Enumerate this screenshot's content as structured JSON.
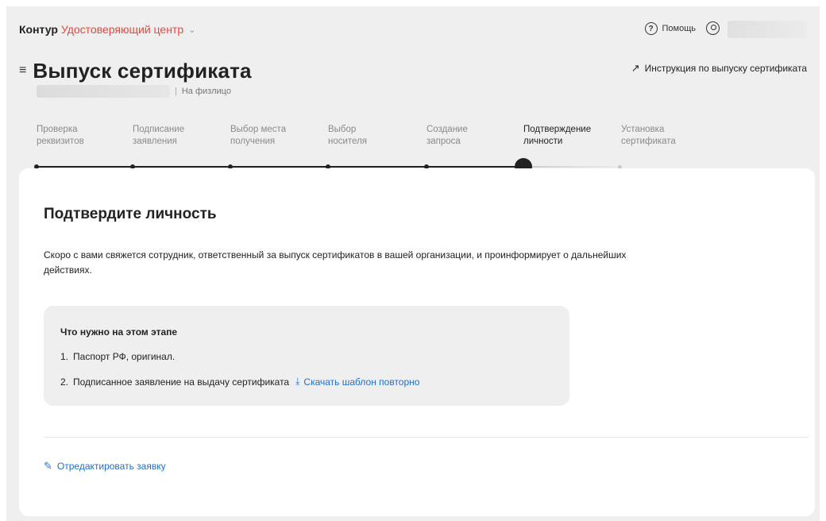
{
  "header": {
    "brand_primary": "Контур",
    "brand_product": "Удостоверяющий центр",
    "help_label": "Помощь",
    "icons": {
      "dropdown": "chevron-down-icon",
      "help": "help-circle-icon",
      "user": "user-icon"
    }
  },
  "page": {
    "title": "Выпуск сертификата",
    "instruction_link": "Инструкция по выпуску сертификата",
    "applicant_type": "На физлицо",
    "icons": {
      "menu": "menu-icon",
      "instruction": "arrow-up-right-icon"
    }
  },
  "steps": [
    {
      "line1": "Проверка",
      "line2": "реквизитов",
      "status": "done"
    },
    {
      "line1": "Подписание",
      "line2": "заявления",
      "status": "done"
    },
    {
      "line1": "Выбор места",
      "line2": "получения",
      "status": "done"
    },
    {
      "line1": "Выбор",
      "line2": "носителя",
      "status": "done"
    },
    {
      "line1": "Создание",
      "line2": "запроса",
      "status": "done"
    },
    {
      "line1": "Подтверждение",
      "line2": "личности",
      "status": "current"
    },
    {
      "line1": "Установка",
      "line2": "сертификата",
      "status": "future"
    }
  ],
  "card": {
    "title": "Подтвердите личность",
    "description": "Скоро с вами свяжется сотрудник, ответственный за выпуск сертификатов в вашей организации, и проинформирует о дальнейших действиях.",
    "requirements": {
      "title": "Что нужно на этом этапе",
      "items": [
        {
          "num": "1.",
          "text": "Паспорт РФ, оригинал."
        },
        {
          "num": "2.",
          "text": "Подписанное заявление на выдачу сертификата"
        }
      ],
      "download_link": "Скачать шаблон повторно"
    },
    "edit_link": "Отредактировать заявку",
    "icons": {
      "download": "download-icon",
      "edit": "pencil-icon"
    }
  },
  "colors": {
    "accent_red": "#e8463a",
    "link_blue": "#1f6fd1",
    "background": "#efefef",
    "card": "#ffffff"
  }
}
